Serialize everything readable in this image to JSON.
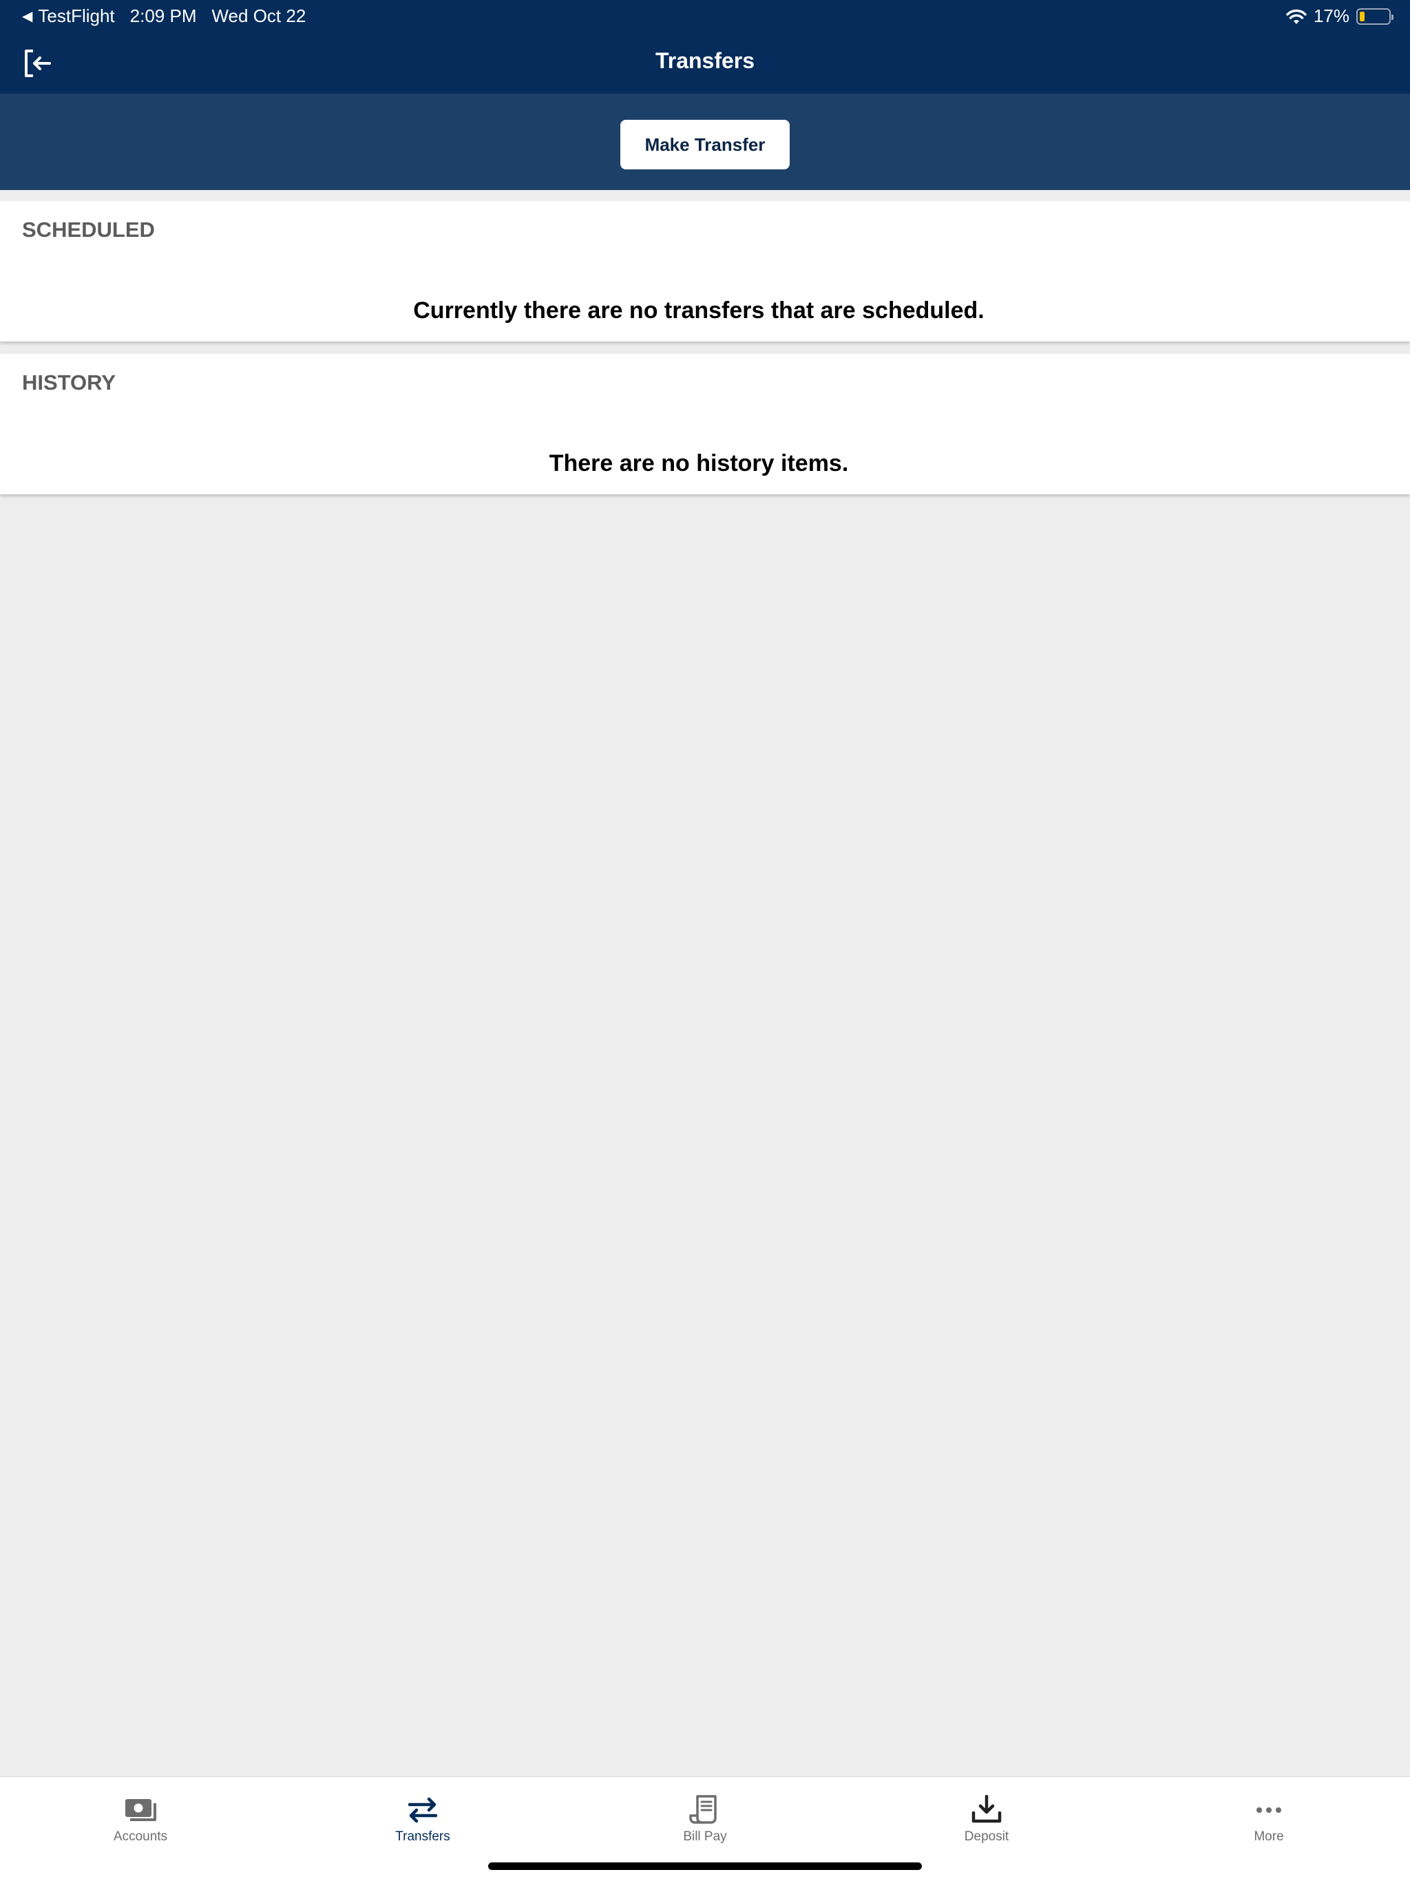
{
  "status_bar": {
    "back_app": "TestFlight",
    "time": "2:09 PM",
    "date": "Wed Oct 22",
    "battery": "17%",
    "battery_level": 0.17
  },
  "nav": {
    "title": "Transfers",
    "exit_icon": "sign-out-icon"
  },
  "actions": {
    "make_transfer_label": "Make Transfer"
  },
  "sections": {
    "scheduled": {
      "header": "SCHEDULED",
      "empty_message": "Currently there are no transfers that are scheduled."
    },
    "history": {
      "header": "HISTORY",
      "empty_message": "There are no history items."
    }
  },
  "tabs": [
    {
      "label": "Accounts",
      "icon": "cash-icon",
      "active": false
    },
    {
      "label": "Transfers",
      "icon": "transfer-arrows-icon",
      "active": true
    },
    {
      "label": "Bill Pay",
      "icon": "receipt-icon",
      "active": false
    },
    {
      "label": "Deposit",
      "icon": "download-tray-icon",
      "active": false
    },
    {
      "label": "More",
      "icon": "more-dots-icon",
      "active": false
    }
  ],
  "colors": {
    "nav_background": "#052c5a",
    "action_band": "#1d4069",
    "page_background": "#ededed",
    "active_tab": "#052c5a"
  }
}
